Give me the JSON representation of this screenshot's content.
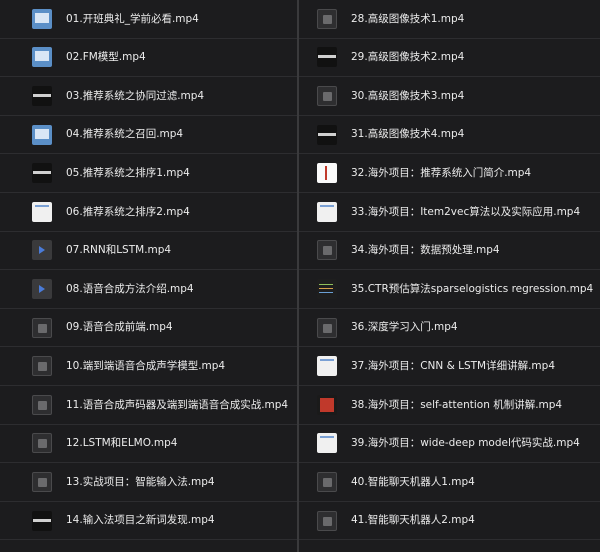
{
  "left_files": [
    {
      "name": "01.开班典礼_学前必看.mp4",
      "thumb": "slide-blue"
    },
    {
      "name": "02.FM模型.mp4",
      "thumb": "slide-blue"
    },
    {
      "name": "03.推荐系统之协同过滤.mp4",
      "thumb": "slide-dark"
    },
    {
      "name": "04.推荐系统之召回.mp4",
      "thumb": "slide-blue"
    },
    {
      "name": "05.推荐系统之排序1.mp4",
      "thumb": "slide-dark"
    },
    {
      "name": "06.推荐系统之排序2.mp4",
      "thumb": "slide-light"
    },
    {
      "name": "07.RNN和LSTM.mp4",
      "thumb": "play"
    },
    {
      "name": "08.语音合成方法介绍.mp4",
      "thumb": "play"
    },
    {
      "name": "09.语音合成前端.mp4",
      "thumb": "video"
    },
    {
      "name": "10.端到端语音合成声学模型.mp4",
      "thumb": "video"
    },
    {
      "name": "11.语音合成声码器及端到端语音合成实战.mp4",
      "thumb": "video"
    },
    {
      "name": "12.LSTM和ELMO.mp4",
      "thumb": "video"
    },
    {
      "name": "13.实战项目：智能输入法.mp4",
      "thumb": "video"
    },
    {
      "name": "14.输入法项目之新词发现.mp4",
      "thumb": "slide-dark"
    }
  ],
  "right_files": [
    {
      "name": "28.高级图像技术1.mp4",
      "thumb": "video"
    },
    {
      "name": "29.高级图像技术2.mp4",
      "thumb": "slide-dark"
    },
    {
      "name": "30.高级图像技术3.mp4",
      "thumb": "video"
    },
    {
      "name": "31.高级图像技术4.mp4",
      "thumb": "slide-dark"
    },
    {
      "name": "32.海外项目：推荐系统入门简介.mp4",
      "thumb": "doc"
    },
    {
      "name": "33.海外项目：Item2vec算法以及实际应用.mp4",
      "thumb": "slide-light"
    },
    {
      "name": "34.海外项目：数据预处理.mp4",
      "thumb": "video"
    },
    {
      "name": "35.CTR预估算法sparselogistics regression.mp4",
      "thumb": "code"
    },
    {
      "name": "36.深度学习入门.mp4",
      "thumb": "video"
    },
    {
      "name": "37.海外项目：CNN & LSTM详细讲解.mp4",
      "thumb": "slide-light"
    },
    {
      "name": "38.海外项目：self-attention 机制讲解.mp4",
      "thumb": "slide-red"
    },
    {
      "name": "39.海外项目：wide-deep model代码实战.mp4",
      "thumb": "slide-light"
    },
    {
      "name": "40.智能聊天机器人1.mp4",
      "thumb": "video"
    },
    {
      "name": "41.智能聊天机器人2.mp4",
      "thumb": "video"
    }
  ]
}
